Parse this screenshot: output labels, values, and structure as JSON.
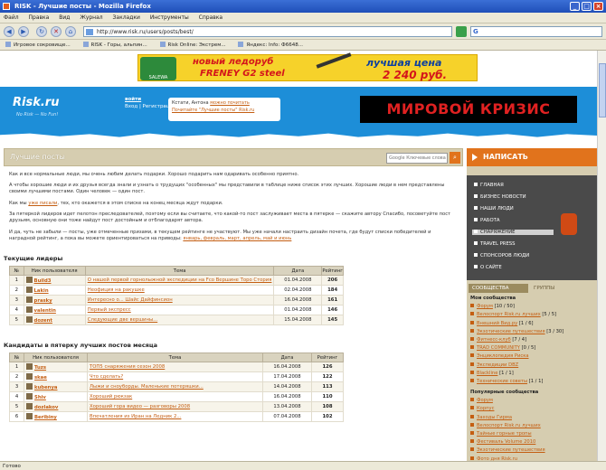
{
  "window": {
    "title": "RISK - Лучшие посты - Mozilla Firefox"
  },
  "menu": [
    "Файл",
    "Правка",
    "Вид",
    "Журнал",
    "Закладки",
    "Инструменты",
    "Справка"
  ],
  "address": {
    "url": "http://www.risk.ru/users/posts/best/"
  },
  "bookmarks": [
    "Игровое сокровище...",
    "RISK - Горы, альпин...",
    "Risk Online: Экстрем...",
    "Яндекс: Info: Ф6648..."
  ],
  "banner": {
    "line1": "новый ледоруб",
    "line2": "FRENEY G2 steel",
    "price_label": "лучшая цена",
    "price": "2 240 руб.",
    "brand": "SALEWA"
  },
  "header": {
    "logo": "Risk.ru",
    "tagline": "No Risk — No Fun!",
    "login": "войти",
    "links": "Вход | Регистрация",
    "note_text": "Кстати, Антона",
    "note_link": "можно почитать",
    "note_text2": "Почитайте \"Лучшие посты\" Risk.ru",
    "crisis": "МИРОВОЙ КРИЗИС"
  },
  "page": {
    "title": "Лучшие посты",
    "search_placeholder": "Google Ключевые слова",
    "p1": "Как и все нормальные люди, мы очень любим делать подарки. Хорошо подарить нам одаривать особенно приятно.",
    "p2": "А чтобы хорошие люди и их друзья всегда знали и узнать о трудущих \"особенных\" мы представили в таблице ниже список этих лучших. Хорошие люди в нем представлены своими лучшими постами. Один человек — один пост.",
    "p3_a": "Как мы ",
    "p3_link": "уже писали",
    "p3_b": ", тех, кто окажется в этом списке на конец месяца ждут подарки.",
    "p4": "За пятеркой лидеров идет пелотон преследователей, поэтому если вы считаете, что какой-то пост заслуживает места в пятерке — скажите автору Спасибо, посоветуйте пост друзьям, основную они тоже найдут пост достойным и отблагодарят автора.",
    "p5_a": "И да, чуть не забыли — посты, уже отмеченные призами, в текущем рейтинге не участвуют. Мы уже начали настраить дизайн почета, где будут списки победителей и наградной рейтинг, а пока вы можете ориентироваться на приводы: ",
    "p5_links": "январь, февраль, март, апрель, май и июнь",
    "sec1": "Текущие лидеры",
    "sec2": "Кандидаты в пятерку лучших постов месяца",
    "cols": [
      "№",
      "Ник пользователя",
      "Тема",
      "Дата",
      "Рейтинг"
    ]
  },
  "leaders": [
    {
      "n": "1",
      "user": "Build3",
      "topic": "О нашей первой горнолыжной экспедиции на Fco Вершине Торо Стория",
      "date": "01.04.2008",
      "rating": "206"
    },
    {
      "n": "2",
      "user": "Lakin",
      "topic": "Неофиция на ракушке",
      "date": "02.04.2008",
      "rating": "184"
    },
    {
      "n": "3",
      "user": "prasky",
      "topic": "Интересно о... Шайс Дайфинсион",
      "date": "16.04.2008",
      "rating": "161"
    },
    {
      "n": "4",
      "user": "valentin",
      "topic": "Первый экспресс",
      "date": "01.04.2008",
      "rating": "146"
    },
    {
      "n": "5",
      "user": "dozent",
      "topic": "Следующие две вершины...",
      "date": "15.04.2008",
      "rating": "145"
    }
  ],
  "candidates": [
    {
      "n": "1",
      "user": "Tuzs",
      "topic": "ТОП5 снаряжения сезон 2008",
      "date": "16.04.2008",
      "rating": "126"
    },
    {
      "n": "2",
      "user": "skae",
      "topic": "Что сделать?",
      "date": "17.04.2008",
      "rating": "122"
    },
    {
      "n": "3",
      "user": "kubenya",
      "topic": "Лыжи и сноуборды. Маленькие потеряшки...",
      "date": "14.04.2008",
      "rating": "113"
    },
    {
      "n": "4",
      "user": "Shiv",
      "topic": "Хороший рюкзак",
      "date": "16.04.2008",
      "rating": "110"
    },
    {
      "n": "5",
      "user": "dozlakov",
      "topic": "Хороший гора видео — разговоры 2008",
      "date": "13.04.2008",
      "rating": "108"
    },
    {
      "n": "6",
      "user": "Beribiny",
      "topic": "Впечатления из Иран на Ледник 2...",
      "date": "07.04.2008",
      "rating": "102"
    }
  ],
  "sidebar": {
    "write": "НАПИСАТЬ",
    "menu": [
      "ГЛАВНАЯ",
      "БИЗНЕС НОВОСТИ",
      "НАШИ ЛЮДИ",
      "РАБОТА",
      "СНАРЯЖЕНИЕ",
      "TRAVEL PRESS",
      "СПОНСОРОВ ЛЮДИ",
      "О САЙТЕ"
    ],
    "active_index": 4,
    "tab1": "СООБЩЕСТВА",
    "tab2": "ГРУППЫ",
    "my_header": "Мои сообщества",
    "my": [
      {
        "name": "Форум",
        "count": "[10 / 50]"
      },
      {
        "name": "Велоспорт Risk.ru лучших",
        "count": "[5 / 5]"
      },
      {
        "name": "Внешний Вид.ру",
        "count": "[1 / 6]"
      },
      {
        "name": "Экзотические путешествия",
        "count": "[3 / 30]"
      },
      {
        "name": "Фитнесс-клуб",
        "count": "[7 / 4]"
      },
      {
        "name": "TRAD COMMUNITY",
        "count": "[0 / 5]"
      },
      {
        "name": "Энциклопедия Риска",
        "count": ""
      },
      {
        "name": "Экспедиции DBZ",
        "count": ""
      },
      {
        "name": "Blackline",
        "count": "[1 / 1]"
      },
      {
        "name": "Технические советы",
        "count": "[1 / 1]"
      }
    ],
    "pop_header": "Популярные сообщества",
    "pop": [
      "Форум",
      "Корпус",
      "Заходы Гирма",
      "Велоспорт Risk.ru лучших",
      "Тайные горные тропы",
      "Фестиваль Volume 2010",
      "Экзотические путешествия",
      "Фото дня Risk.ru"
    ]
  },
  "status": "Готово"
}
